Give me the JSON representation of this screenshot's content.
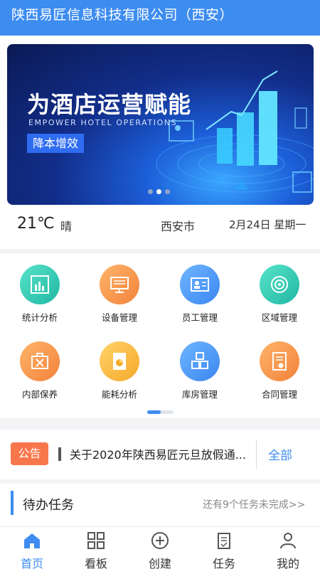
{
  "header": {
    "title": "陕西易匠信息科技有限公司（西安）"
  },
  "banner": {
    "title": "为酒店运营赋能",
    "subtitle": "EMPOWER HOTEL OPERATIONS",
    "badge": "降本增效",
    "slide_count": 3,
    "active_slide": 2
  },
  "weather": {
    "temperature": "21℃",
    "condition": "晴",
    "city": "西安市",
    "date": "2月24日 星期一"
  },
  "grid": {
    "items": [
      {
        "label": "统计分析",
        "icon": "bar-chart-icon",
        "color": "#2fc4ad"
      },
      {
        "label": "设备管理",
        "icon": "monitor-icon",
        "color": "#f5913f"
      },
      {
        "label": "员工管理",
        "icon": "id-card-icon",
        "color": "#4591f3"
      },
      {
        "label": "区域管理",
        "icon": "radar-icon",
        "color": "#2fc4ad"
      },
      {
        "label": "内部保养",
        "icon": "tools-icon",
        "color": "#f5913f"
      },
      {
        "label": "能耗分析",
        "icon": "pie-document-icon",
        "color": "#f7b23b"
      },
      {
        "label": "库房管理",
        "icon": "boxes-icon",
        "color": "#4591f3"
      },
      {
        "label": "合同管理",
        "icon": "contract-icon",
        "color": "#f5913f"
      }
    ],
    "page": 1,
    "page_count": 2
  },
  "notice": {
    "badge": "公告",
    "text": "关于2020年陕西易匠元旦放假通...",
    "all_label": "全部"
  },
  "tasks": {
    "title": "待办任务",
    "more": "还有9个任务未完成>>"
  },
  "tabbar": {
    "active_color": "#3d8cf0",
    "items": [
      {
        "label": "首页",
        "icon": "home-icon"
      },
      {
        "label": "看板",
        "icon": "dashboard-grid-icon"
      },
      {
        "label": "创建",
        "icon": "plus-circle-icon"
      },
      {
        "label": "任务",
        "icon": "task-clipboard-icon"
      },
      {
        "label": "我的",
        "icon": "user-icon"
      }
    ]
  }
}
